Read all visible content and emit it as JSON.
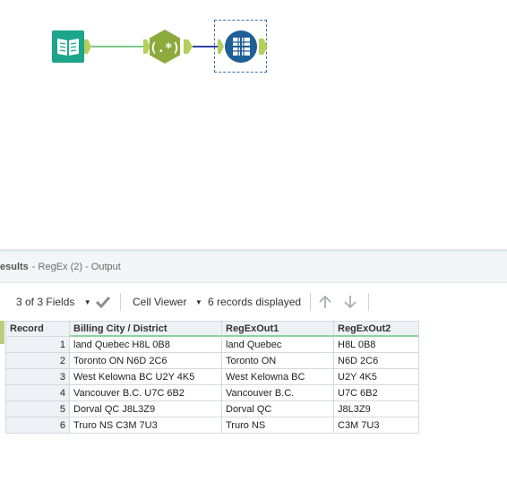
{
  "results": {
    "title": "esults",
    "subtitle": "- RegEx (2) - Output"
  },
  "toolbar": {
    "fields_label": "3 of 3 Fields",
    "viewer_label": "Cell Viewer",
    "records_label": "6 records displayed"
  },
  "grid": {
    "columns": [
      "Record",
      "Billing City / District",
      "RegExOut1",
      "RegExOut2"
    ],
    "rows": [
      [
        "1",
        "land Quebec H8L 0B8",
        "land Quebec",
        "H8L 0B8"
      ],
      [
        "2",
        "Toronto ON N6D 2C6",
        "Toronto ON",
        "N6D 2C6"
      ],
      [
        "3",
        "West Kelowna BC U2Y 4K5",
        "West Kelowna BC",
        "U2Y 4K5"
      ],
      [
        "4",
        "Vancouver B.C. U7C 6B2",
        "Vancouver B.C.",
        "U7C 6B2"
      ],
      [
        "5",
        "Dorval QC J8L3Z9",
        "Dorval QC",
        "J8L3Z9"
      ],
      [
        "6",
        "Truro NS C3M 7U3",
        "Truro NS",
        "C3M 7U3"
      ]
    ]
  },
  "colors": {
    "input_tool": "#1ba58a",
    "regex_tool": "#8dab3c",
    "browse_tool": "#1d5f96",
    "connector_green": "#7fc58a",
    "connector_blue": "#2e3fa8",
    "anchor": "#b6cf5c"
  },
  "icons": {
    "input_tool": "book-icon",
    "regex_tool": "regex-icon",
    "browse_tool": "browse-icon",
    "fields_dropdown": "chevron-down-icon",
    "apply": "check-icon",
    "viewer_dropdown": "chevron-down-icon",
    "prev": "arrow-up-icon",
    "next": "arrow-down-icon"
  }
}
